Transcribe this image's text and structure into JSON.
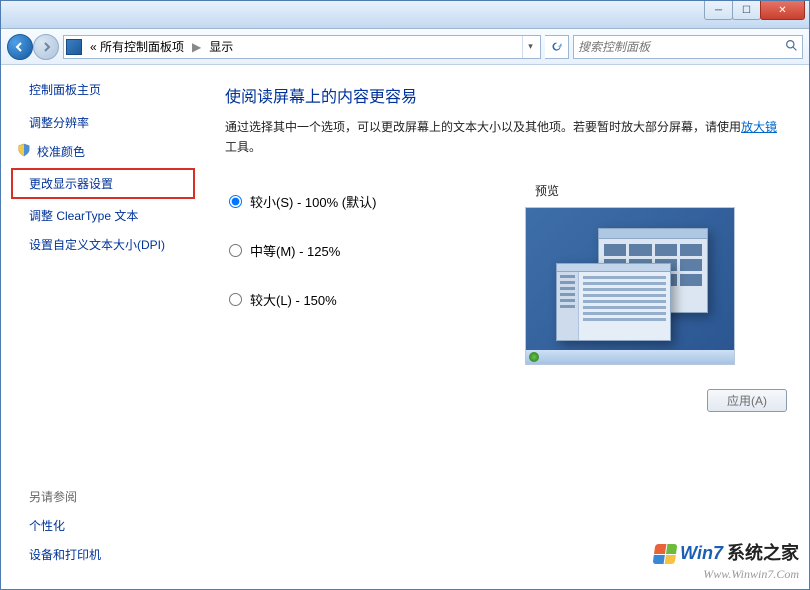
{
  "breadcrumb": {
    "seg1": "« 所有控制面板项",
    "sep": "▶",
    "seg2": "显示"
  },
  "search": {
    "placeholder": "搜索控制面板"
  },
  "sidebar": {
    "header": "控制面板主页",
    "links": [
      "调整分辨率",
      "校准颜色",
      "更改显示器设置",
      "调整 ClearType 文本",
      "设置自定义文本大小(DPI)"
    ],
    "footer_header": "另请参阅",
    "footer_links": [
      "个性化",
      "设备和打印机"
    ]
  },
  "content": {
    "title": "使阅读屏幕上的内容更容易",
    "desc_pre": "通过选择其中一个选项，可以更改屏幕上的文本大小以及其他项。若要暂时放大部分屏幕，请使用",
    "desc_link": "放大镜",
    "desc_post": "工具。",
    "options": [
      "较小(S) - 100% (默认)",
      "中等(M) - 125%",
      "较大(L) - 150%"
    ],
    "preview_label": "预览",
    "apply_label": "应用(A)"
  },
  "watermark": {
    "brand_prefix": "Win7",
    "brand_suffix": "系统之家",
    "url": "Www.Winwin7.Com"
  }
}
